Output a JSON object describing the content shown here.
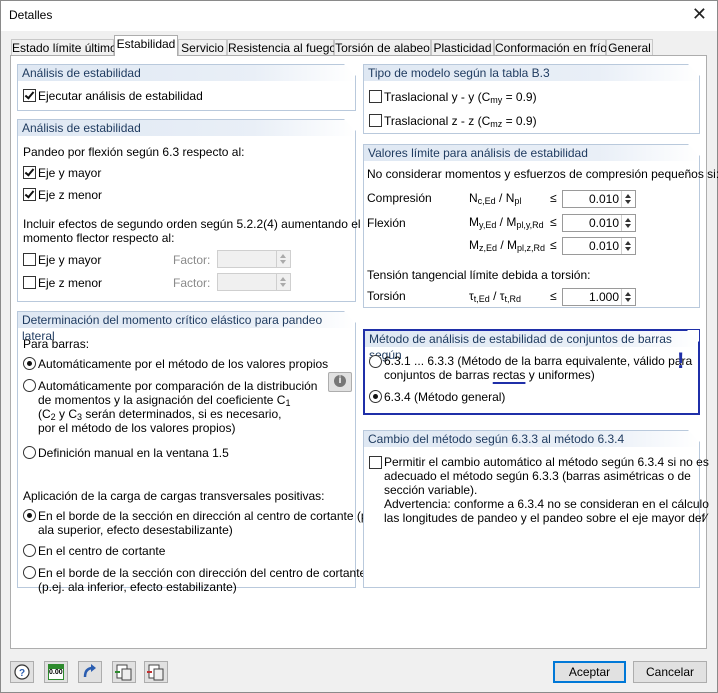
{
  "window": {
    "title": "Detalles",
    "close": "✕"
  },
  "tabs": [
    "Estado límite último",
    "Estabilidad",
    "Servicio",
    "Resistencia al fuego",
    "Torsión de alabeo",
    "Plasticidad",
    "Conformación en frío",
    "General"
  ],
  "active_tab": "Estabilidad",
  "g1": {
    "title": "Análisis de estabilidad",
    "check_label": "Ejecutar análisis de estabilidad",
    "checked": true
  },
  "g2": {
    "title": "Análisis de estabilidad",
    "pandeo_label": "Pandeo por flexión según 6.3 respecto al:",
    "eje_y_mayor": "Eje y mayor",
    "eje_z_menor": "Eje z menor",
    "incluir_line1": "Incluir efectos de segundo orden según 5.2.2(4) aumentando el",
    "incluir_line2": "momento flector respecto al:",
    "eje_y_mayor_2": "Eje y mayor",
    "eje_z_menor_2": "Eje z menor",
    "factor_label": "Factor:"
  },
  "g3": {
    "title": "Determinación del momento crítico elástico para pandeo lateral",
    "para_barras": "Para barras:",
    "opt1": "Automáticamente por el método de los valores propios",
    "opt2_l1": "Automáticamente por comparación de la distribución",
    "opt2_l2": "de momentos y la asignación del coeficiente C",
    "opt2_l2_sub": "1",
    "opt2_l3_a": "(C",
    "opt2_l3_sub1": "2",
    "opt2_l3_b": " y C",
    "opt2_l3_sub2": "3",
    "opt2_l3_c": " serán determinados, si es necesario,",
    "opt2_l4": " por el método de los valores propios)",
    "opt3": "Definición manual en la ventana 1.5",
    "aplicacion": "Aplicación de la carga de cargas transversales positivas:",
    "load1_l1": "En el borde de la sección en dirección al centro de cortante (p.ej.",
    "load1_l2": "ala superior, efecto desestabilizante)",
    "load2": "En el centro de cortante",
    "load3_l1": "En el borde de la sección con dirección del centro de cortante",
    "load3_l2": "(p.ej. ala inferior, efecto estabilizante)"
  },
  "g4": {
    "title": "Tipo de modelo según la tabla B.3",
    "tras_y": "Traslacional y - y (C",
    "tras_y_sub": "my",
    "tras_y_end": " = 0.9)",
    "tras_z": "Traslacional z - z (C",
    "tras_z_sub": "mz",
    "tras_z_end": " = 0.9)"
  },
  "g5": {
    "title": "Valores límite para análisis de estabilidad",
    "intro": "No considerar momentos y esfuerzos de compresión pequeños si:",
    "compresion": "Compresión",
    "flexion": "Flexión",
    "torsion_intro": "Tensión tangencial límite debida a torsión:",
    "torsion": "Torsión",
    "f1": {
      "a": "N",
      "as": "c,Ed",
      "b": " / N",
      "bs": "pl"
    },
    "f2": {
      "a": "M",
      "as": "y,Ed",
      "b": " / M",
      "bs": "pl,y,Rd"
    },
    "f3": {
      "a": "M",
      "as": "z,Ed",
      "b": " / M",
      "bs": "pl,z,Rd"
    },
    "f4": {
      "a": "τ",
      "as": "t,Ed",
      "b": " / τ",
      "bs": "t,Rd"
    },
    "le": "≤",
    "v1": "0.010",
    "v2": "0.010",
    "v3": "0.010",
    "v4": "1.000"
  },
  "g6": {
    "title": "Método de análisis de estabilidad de conjuntos de barras según",
    "opt1_l1": "6.3.1 ... 6.3.3 (Método de la barra equivalente, válido para",
    "opt1_l2a": "conjuntos de barras ",
    "opt1_l2b": "rectas",
    "opt1_l2c": " y uniformes)",
    "opt2": "6.3.4  (Método general)",
    "mark": "!",
    "highlight_color": "#1f2fa8"
  },
  "g7": {
    "title": "Cambio del método según 6.3.3 al método 6.3.4",
    "l1": "Permitir el cambio automático al método según 6.3.4 si no es",
    "l2": "adecuado el método según 6.3.3 (barras asimétricas o de",
    "l3": "sección variable).",
    "l4": "Advertencia: conforme a 6.3.4 no se consideran en el cálculo",
    "l5": "las longitudes de pandeo y el pandeo sobre el eje mayor def⁄"
  },
  "footer": {
    "ok": "Aceptar",
    "cancel": "Cancelar",
    "zero_label": "0.00"
  }
}
